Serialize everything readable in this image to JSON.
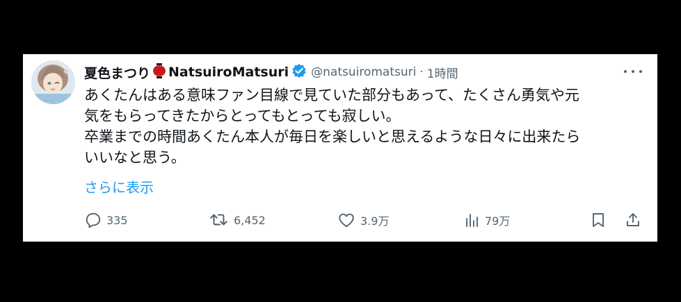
{
  "tweet": {
    "display_name": "夏色まつり",
    "name_suffix": "NatsuiroMatsuri",
    "handle": "@natsuiromatsuri",
    "separator": "·",
    "time": "1時間",
    "lines": [
      "あくたんはある意味ファン目線で見ていた部分もあって、たくさん勇気や元",
      "気をもらってきたからとってもとっても寂しい。",
      "卒業までの時間あくたん本人が毎日を楽しいと思えるような日々に出来たら",
      "いいなと思う。"
    ],
    "show_more": "さらに表示"
  },
  "actions": {
    "reply": {
      "icon": "reply-icon",
      "count": "335"
    },
    "retweet": {
      "icon": "retweet-icon",
      "count": "6,452"
    },
    "like": {
      "icon": "heart-icon",
      "count": "3.9万"
    },
    "views": {
      "icon": "views-icon",
      "count": "79万"
    },
    "bookmark": {
      "icon": "bookmark-icon"
    },
    "share": {
      "icon": "share-icon"
    }
  },
  "colors": {
    "text": "#0f1419",
    "secondary": "#536471",
    "link": "#1d9bf0",
    "verified": "#1d9bf0",
    "lantern": "#d91e1e"
  }
}
